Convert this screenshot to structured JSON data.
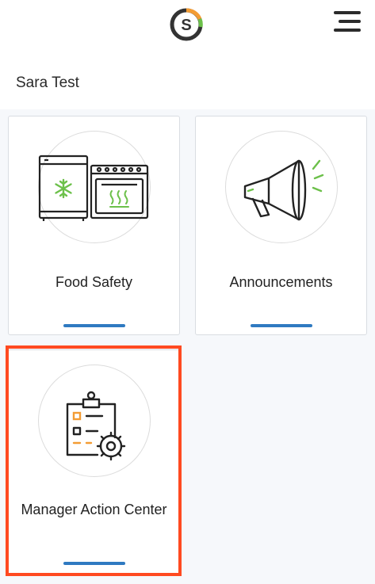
{
  "header": {
    "logo_letter": "S",
    "menu_icon": "hamburger-menu-icon",
    "user_name": "Sara Test"
  },
  "tiles": [
    {
      "label": "Food Safety",
      "icon": "fridge-oven-icon"
    },
    {
      "label": "Announcements",
      "icon": "megaphone-icon"
    },
    {
      "label": "Manager Action Center",
      "icon": "clipboard-gear-icon"
    }
  ],
  "colors": {
    "accent_bar": "#2f7ac1",
    "icon_green": "#6cc04a",
    "icon_orange": "#f39c34",
    "highlight": "#ff4a21"
  }
}
